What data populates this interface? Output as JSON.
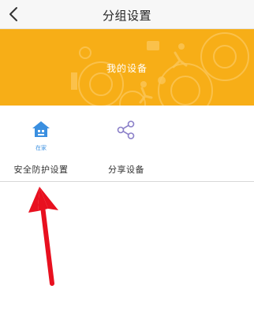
{
  "nav": {
    "title": "分组设置",
    "back_icon": "chevron-left-icon"
  },
  "banner": {
    "label": "我的设备",
    "background_color": "#f7ae17"
  },
  "groups": [
    {
      "icon": "home-icon",
      "sub_label": "在家",
      "label": "安全防护设置",
      "accent": "#3a8fe0"
    },
    {
      "icon": "share-icon",
      "sub_label": "",
      "label": "分享设备",
      "accent": "#8a7fc8"
    }
  ],
  "annotation": {
    "arrow_icon": "red-arrow-up-icon",
    "color": "#e8101f"
  }
}
